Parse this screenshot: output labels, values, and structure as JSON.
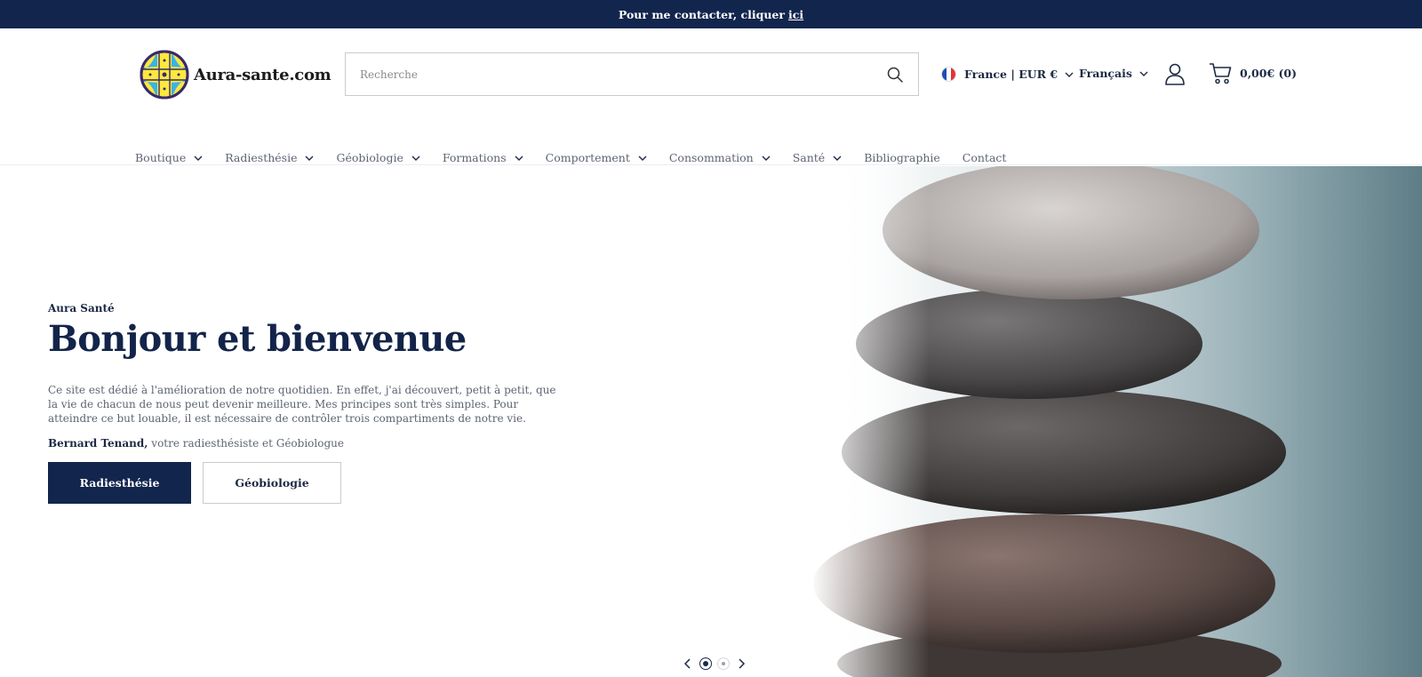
{
  "announcement": {
    "text": "Pour me contacter, cliquer",
    "link": "ici"
  },
  "logo": {
    "text": "Aura-sante.com"
  },
  "search": {
    "placeholder": "Recherche"
  },
  "country": {
    "label": "France | EUR €",
    "flag_colors": [
      "#1f4fb3",
      "#ffffff",
      "#e1333a"
    ]
  },
  "language": {
    "label": "Français"
  },
  "cart": {
    "label": "0,00€ (0)"
  },
  "nav": {
    "items": [
      {
        "label": "Boutique",
        "has_dropdown": true
      },
      {
        "label": "Radiesthésie",
        "has_dropdown": true
      },
      {
        "label": "Géobiologie",
        "has_dropdown": true
      },
      {
        "label": "Formations",
        "has_dropdown": true
      },
      {
        "label": "Comportement",
        "has_dropdown": true
      },
      {
        "label": "Consommation",
        "has_dropdown": true
      },
      {
        "label": "Santé",
        "has_dropdown": true
      },
      {
        "label": "Bibliographie",
        "has_dropdown": false
      },
      {
        "label": "Contact",
        "has_dropdown": false
      }
    ]
  },
  "hero": {
    "subtitle": "Aura Santé",
    "heading": "Bonjour et bienvenue",
    "description": "Ce site est dédié à l'amélioration de notre quotidien. En effet, j'ai découvert, petit à petit, que la vie de chacun de nous peut devenir meilleure. Mes principes sont très simples. Pour atteindre ce but louable,  il est nécessaire de contrôler trois compartiments de notre vie.",
    "signature_name": "Bernard Tenand,",
    "signature_role": " votre radiesthésiste et Géobiologue",
    "primary_button": "Radiesthésie",
    "secondary_button": "Géobiologie"
  },
  "slider": {
    "slides": 2,
    "active": 1
  },
  "colors": {
    "brand": "#12254d",
    "text_muted": "#5d6472"
  }
}
